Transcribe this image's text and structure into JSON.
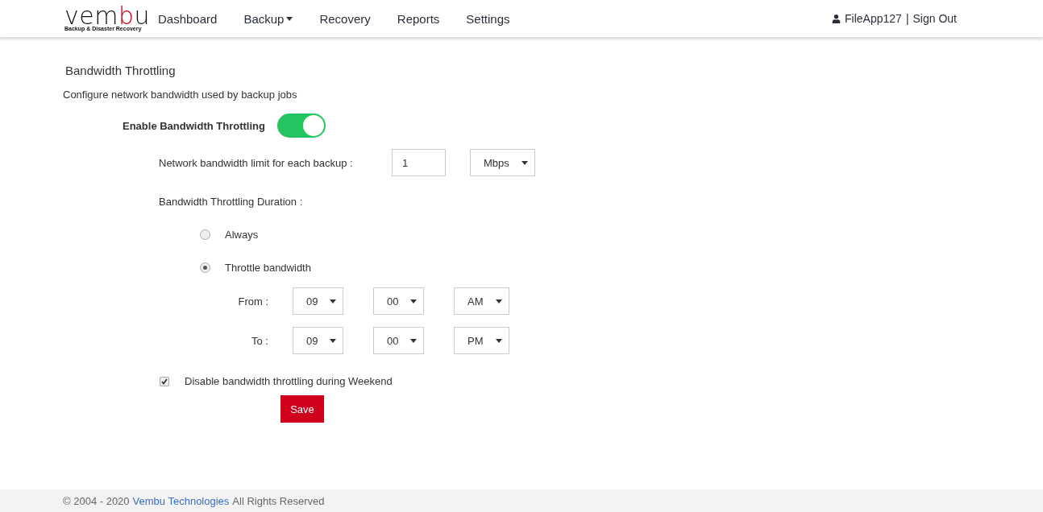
{
  "logo": {
    "parts": [
      {
        "text": "vem",
        "kind": "plain"
      },
      {
        "text": "b",
        "kind": "accent"
      },
      {
        "text": "u",
        "kind": "plain"
      }
    ],
    "tagline": "Backup & Disaster Recovery"
  },
  "nav": [
    {
      "label": "Dashboard",
      "dropdown": false
    },
    {
      "label": "Backup",
      "dropdown": true
    },
    {
      "label": "Recovery",
      "dropdown": false
    },
    {
      "label": "Reports",
      "dropdown": false
    },
    {
      "label": "Settings",
      "dropdown": false
    }
  ],
  "user": {
    "name": "FileApp127",
    "separator": "|",
    "signout": "Sign Out"
  },
  "page": {
    "title": "Bandwidth Throttling",
    "subtitle": "Configure network bandwidth used by backup jobs"
  },
  "toggle": {
    "label": "Enable Bandwidth Throttling",
    "on": true
  },
  "limit": {
    "label": "Network bandwidth limit for each backup :",
    "value": "1",
    "unit": "Mbps"
  },
  "duration": {
    "label": "Bandwidth Throttling Duration :",
    "options": [
      {
        "label": "Always",
        "selected": false
      },
      {
        "label": "Throttle bandwidth",
        "selected": true
      }
    ]
  },
  "times": [
    {
      "label": "From :",
      "hour": "09",
      "minute": "00",
      "period": "AM"
    },
    {
      "label": "To :",
      "hour": "09",
      "minute": "00",
      "period": "PM"
    }
  ],
  "weekend": {
    "label": "Disable bandwidth throttling during Weekend",
    "checked": true
  },
  "save": "Save",
  "footer": {
    "copyright": "© 2004 - 2020",
    "link": "Vembu Technologies",
    "rest": "All Rights Reserved"
  }
}
